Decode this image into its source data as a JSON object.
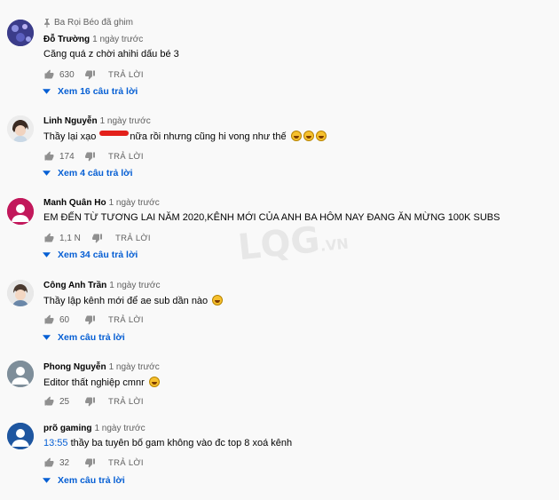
{
  "comments": [
    {
      "pinned_by": "Ba Rọi Béo đã ghim",
      "author": "Đỗ Trường",
      "time": "1 ngày trước",
      "text": "Căng quá z chời ahihi dấu bé 3",
      "likes": "630",
      "reply_label": "TRẢ LỜI",
      "view_replies": "Xem 16 câu trả lời",
      "avatar_color": "#3b3c8a"
    },
    {
      "author": "Linh Nguyễn",
      "time": "1 ngày trước",
      "text_before": "Thầy lại xạo",
      "text_after": "nữa rồi nhưng cũng hi vong như thế",
      "likes": "174",
      "reply_label": "TRẢ LỜI",
      "view_replies": "Xem 4 câu trả lời",
      "avatar_color": "#d9d9d9"
    },
    {
      "author": "Manh Quân Ho",
      "time": "1 ngày trước",
      "text": "EM ĐẾN TỪ TƯƠNG LAI NĂM 2020,KÊNH MỚI CỦA ANH BA HÔM NAY ĐANG ĂN MỪNG 100K SUBS",
      "likes": "1,1 N",
      "reply_label": "TRẢ LỜI",
      "view_replies": "Xem 34 câu trả lời",
      "avatar_color": "#c2185b"
    },
    {
      "author": "Công Anh Trần",
      "time": "1 ngày trước",
      "text": "Thầy lập kênh mới để ae sub dần nào",
      "likes": "60",
      "reply_label": "TRẢ LỜI",
      "view_replies": "Xem câu trả lời",
      "avatar_color": "#cfcfcf"
    },
    {
      "author": "Phong Nguyễn",
      "time": "1 ngày trước",
      "text": "Editor thất nghiệp cmnr",
      "likes": "25",
      "reply_label": "TRẢ LỜI",
      "avatar_color": "#7e8e9a"
    },
    {
      "author": "prõ gaming",
      "time": "1 ngày trước",
      "timestamp_link": "13:55",
      "text": "thầy ba tuyên bố gam không vào đc top 8 xoá kênh",
      "likes": "32",
      "reply_label": "TRẢ LỜI",
      "view_replies": "Xem câu trả lời",
      "avatar_color": "#1e56a0"
    }
  ],
  "watermark": {
    "main": "LQG",
    "suffix": ".VN"
  },
  "colors": {
    "link": "#065fd4",
    "muted": "#606060",
    "background": "#f9f9f9"
  },
  "icons": [
    "pin-icon",
    "thumb-up-icon",
    "thumb-down-icon",
    "chevron-down-icon",
    "laughing-emoji-icon"
  ]
}
